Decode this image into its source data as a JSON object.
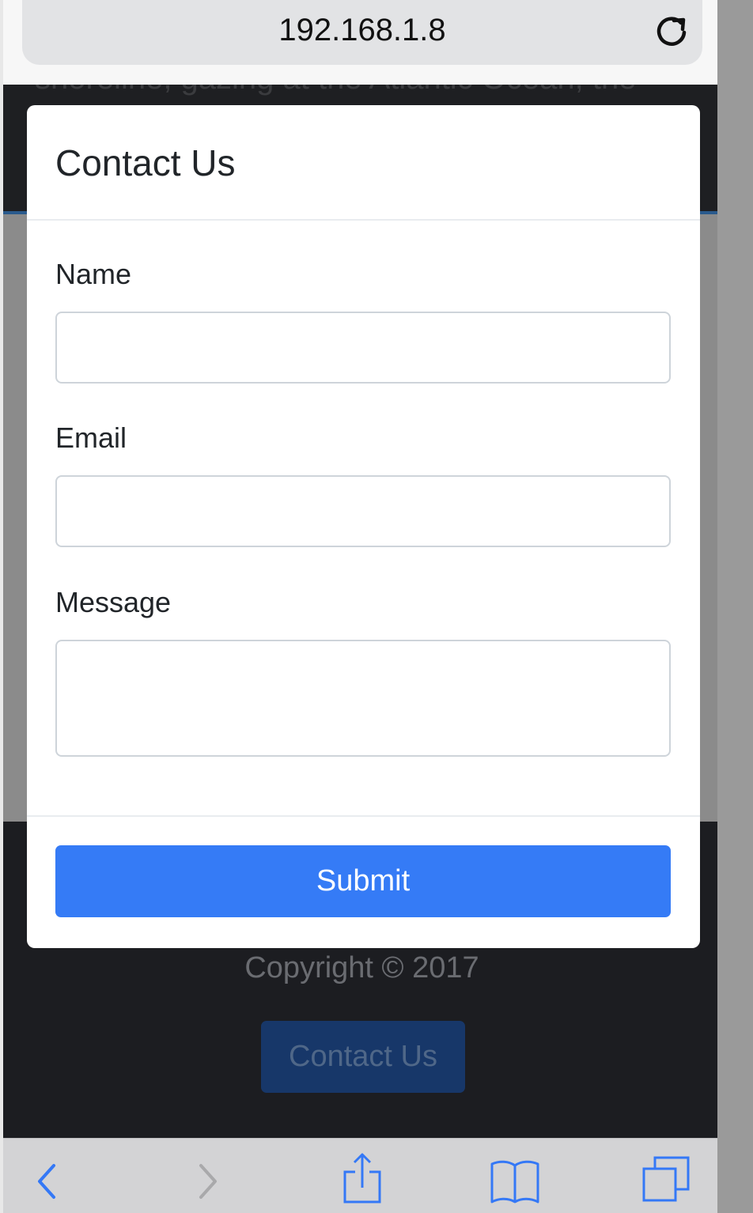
{
  "browser": {
    "url": "192.168.1.8",
    "reload_icon": "reload-icon"
  },
  "background_page": {
    "hero_text_fragment": "shoreline, gazing at the Atlantic Ocean, the",
    "copyright": "Copyright © 2017",
    "contact_button_label": "Contact Us"
  },
  "modal": {
    "title": "Contact Us",
    "fields": [
      {
        "label": "Name",
        "value": ""
      },
      {
        "label": "Email",
        "value": ""
      },
      {
        "label": "Message",
        "value": ""
      }
    ],
    "submit_label": "Submit",
    "submit_color": "#357bf6"
  },
  "toolbar": {
    "items": [
      "back-icon",
      "forward-icon",
      "share-icon",
      "bookmarks-icon",
      "tabs-icon"
    ],
    "accent_color": "#3478f6"
  }
}
